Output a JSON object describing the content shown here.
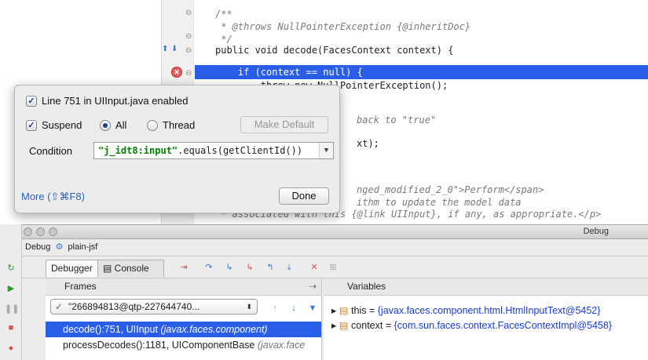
{
  "editor": {
    "lines": [
      {
        "id": "l1",
        "text": "/**"
      },
      {
        "id": "l2",
        "text": " * @throws NullPointerException {@inheritDoc}"
      },
      {
        "id": "l3",
        "text": " */"
      },
      {
        "id": "l4",
        "text": "public void decode(FacesContext context) {"
      },
      {
        "id": "l5",
        "text": "    if (context == null) {"
      },
      {
        "id": "l6",
        "text": "        throw new NullPointerException();"
      },
      {
        "id": "l7",
        "text": "back to \"true\""
      },
      {
        "id": "l8",
        "text": "xt);"
      },
      {
        "id": "l9",
        "text": "nged_modified_2_0\">Perform</span>"
      },
      {
        "id": "l10",
        "text": "ithm to update the model data"
      },
      {
        "id": "l11",
        "text": " * associated with this {@link UIInput}, if any, as appropriate.</p>"
      }
    ],
    "breakpoint_icon": "breakpoint-icon"
  },
  "popup": {
    "title": "Line 751 in UIInput.java enabled",
    "suspend_label": "Suspend",
    "all_label": "All",
    "thread_label": "Thread",
    "make_default": "Make Default",
    "condition_label": "Condition",
    "condition_str": "\"j_idt8:input\"",
    "condition_rest": ".equals(getClientId())",
    "more_link": "More (⇧⌘F8)",
    "done": "Done"
  },
  "debug": {
    "window_title": "Debug",
    "config_name": "plain-jsf",
    "debug_label": "Debug",
    "tabs": [
      {
        "id": "debugger",
        "label": "Debugger"
      },
      {
        "id": "console",
        "label": "Console"
      }
    ],
    "frames_label": "Frames",
    "variables_label": "Variables",
    "thread": "\"266894813@qtp-227644740...",
    "frames": [
      {
        "method": "decode():751, UIInput",
        "pkg": "(javax.faces.component)"
      },
      {
        "method": "processDecodes():1181, UIComponentBase",
        "pkg": "(javax.face"
      }
    ],
    "variables": [
      {
        "name": "this",
        "value": "{javax.faces.component.html.HtmlInputText@5452}"
      },
      {
        "name": "context",
        "value": "{com.sun.faces.context.FacesContextImpl@5458}"
      }
    ]
  },
  "colors": {
    "selection": "#2a5de8",
    "link": "#2a63b8"
  }
}
